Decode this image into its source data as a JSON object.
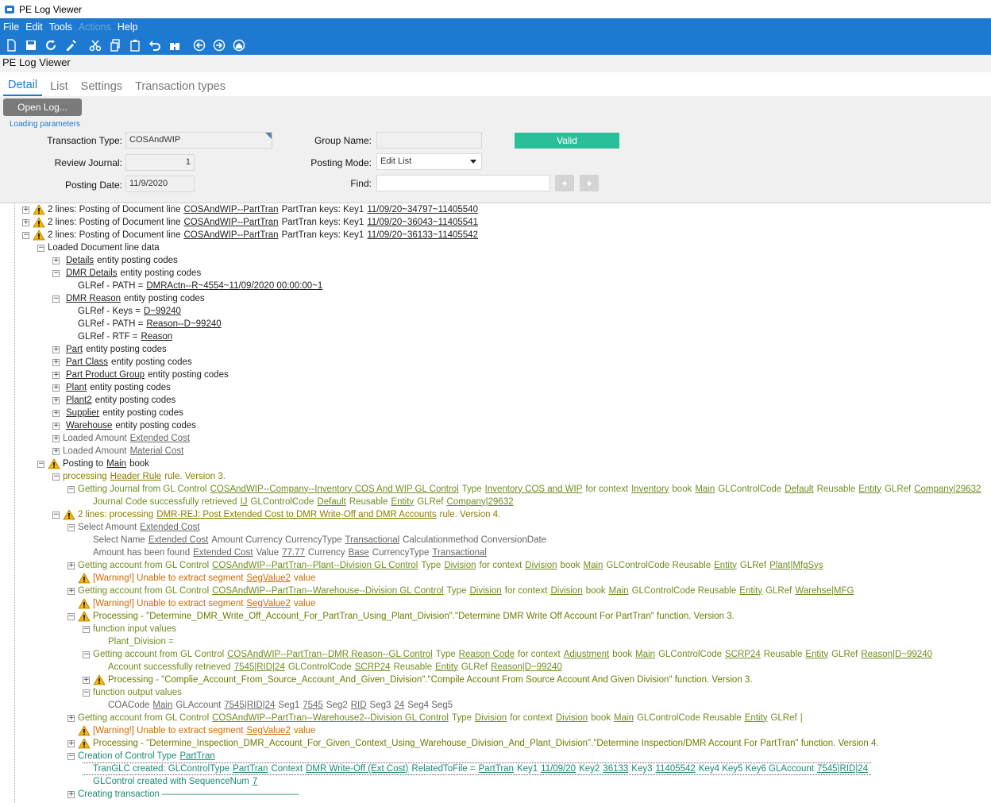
{
  "window": {
    "title": "PE Log Viewer"
  },
  "menu": {
    "file": "File",
    "edit": "Edit",
    "tools": "Tools",
    "actions": "Actions",
    "help": "Help"
  },
  "header": {
    "title": "PE Log Viewer"
  },
  "tabs": {
    "detail": "Detail",
    "list": "List",
    "settings": "Settings",
    "transaction_types": "Transaction types"
  },
  "params": {
    "open_log": "Open Log...",
    "loading_parameters": "Loading parameters",
    "transaction_type_label": "Transaction Type:",
    "transaction_type_value": "COSAndWIP",
    "review_journal_label": "Review Journal:",
    "review_journal_value": "1",
    "posting_date_label": "Posting Date:",
    "posting_date_value": "11/9/2020",
    "group_name_label": "Group Name:",
    "group_name_value": "",
    "posting_mode_label": "Posting Mode:",
    "posting_mode_value": "Edit List",
    "find_label": "Find:",
    "find_value": "",
    "status": "Valid"
  },
  "tree": [
    {
      "depth": 0,
      "exp": "+",
      "warn": true,
      "color": "c-black",
      "parts": [
        "2 lines: Posting of Document line",
        {
          "u": "COSAndWIP--PartTran"
        },
        "PartTran keys:  Key1",
        {
          "u": "11/09/20~34797~11405540"
        }
      ]
    },
    {
      "depth": 0,
      "exp": "+",
      "warn": true,
      "color": "c-black",
      "parts": [
        "2 lines: Posting of Document line",
        {
          "u": "COSAndWIP--PartTran"
        },
        "PartTran keys:  Key1",
        {
          "u": "11/09/20~36043~11405541"
        }
      ]
    },
    {
      "depth": 0,
      "exp": "-",
      "warn": true,
      "color": "c-black",
      "parts": [
        "2 lines: Posting of Document line",
        {
          "u": "COSAndWIP--PartTran"
        },
        "PartTran keys:  Key1",
        {
          "u": "11/09/20~36133~11405542"
        }
      ]
    },
    {
      "depth": 1,
      "exp": "-",
      "warn": false,
      "color": "c-black",
      "parts": [
        "Loaded Document line data"
      ]
    },
    {
      "depth": 2,
      "exp": "+",
      "warn": false,
      "color": "c-black",
      "parts": [
        {
          "u": "Details"
        },
        "entity posting codes"
      ]
    },
    {
      "depth": 2,
      "exp": "-",
      "warn": false,
      "color": "c-black",
      "parts": [
        {
          "u": "DMR Details"
        },
        "entity posting codes"
      ]
    },
    {
      "depth": 3,
      "exp": "",
      "warn": false,
      "color": "c-black",
      "parts": [
        "GLRef - PATH =",
        {
          "u": "DMRActn--R~4554~11/09/2020 00:00:00~1"
        }
      ]
    },
    {
      "depth": 2,
      "exp": "-",
      "warn": false,
      "color": "c-black",
      "parts": [
        {
          "u": "DMR Reason"
        },
        "entity posting codes"
      ]
    },
    {
      "depth": 3,
      "exp": "",
      "warn": false,
      "color": "c-black",
      "parts": [
        "GLRef - Keys =",
        {
          "u": "D~99240"
        }
      ]
    },
    {
      "depth": 3,
      "exp": "",
      "warn": false,
      "color": "c-black",
      "parts": [
        "GLRef - PATH =",
        {
          "u": "Reason--D~99240"
        }
      ]
    },
    {
      "depth": 3,
      "exp": "",
      "warn": false,
      "color": "c-black",
      "parts": [
        "GLRef - RTF =",
        {
          "u": "Reason"
        }
      ]
    },
    {
      "depth": 2,
      "exp": "+",
      "warn": false,
      "color": "c-black",
      "parts": [
        {
          "u": "Part"
        },
        "entity posting codes"
      ]
    },
    {
      "depth": 2,
      "exp": "+",
      "warn": false,
      "color": "c-black",
      "parts": [
        {
          "u": "Part Class"
        },
        "entity posting codes"
      ]
    },
    {
      "depth": 2,
      "exp": "+",
      "warn": false,
      "color": "c-black",
      "parts": [
        {
          "u": "Part Product Group"
        },
        "entity posting codes"
      ]
    },
    {
      "depth": 2,
      "exp": "+",
      "warn": false,
      "color": "c-black",
      "parts": [
        {
          "u": "Plant"
        },
        "entity posting codes"
      ]
    },
    {
      "depth": 2,
      "exp": "+",
      "warn": false,
      "color": "c-black",
      "parts": [
        {
          "u": "Plant2"
        },
        "entity posting codes"
      ]
    },
    {
      "depth": 2,
      "exp": "+",
      "warn": false,
      "color": "c-black",
      "parts": [
        {
          "u": "Supplier"
        },
        "entity posting codes"
      ]
    },
    {
      "depth": 2,
      "exp": "+",
      "warn": false,
      "color": "c-black",
      "parts": [
        {
          "u": "Warehouse"
        },
        "entity posting codes"
      ]
    },
    {
      "depth": 2,
      "exp": "+",
      "warn": false,
      "color": "c-gray",
      "parts": [
        "Loaded Amount",
        {
          "u": "Extended Cost"
        }
      ]
    },
    {
      "depth": 2,
      "exp": "+",
      "warn": false,
      "color": "c-gray",
      "parts": [
        "Loaded Amount",
        {
          "u": "Material Cost"
        }
      ]
    },
    {
      "depth": 1,
      "exp": "-",
      "warn": true,
      "color": "c-black",
      "parts": [
        "Posting to",
        {
          "u": "Main"
        },
        "book"
      ]
    },
    {
      "depth": 2,
      "exp": "-",
      "warn": false,
      "color": "c-olive",
      "parts": [
        "processing",
        {
          "u": "Header Rule"
        },
        "rule. Version 3."
      ]
    },
    {
      "depth": 3,
      "exp": "-",
      "warn": false,
      "color": "c-green",
      "parts": [
        "Getting Journal from GL Control",
        {
          "u": "COSAndWIP--Company--Inventory COS And WIP GL Control"
        },
        "Type",
        {
          "u": "Inventory COS and WIP"
        },
        "for context",
        {
          "u": "Inventory"
        },
        "book",
        {
          "u": "Main"
        },
        "GLControlCode",
        {
          "u": "Default"
        },
        "Reusable",
        {
          "u": "Entity"
        },
        "GLRef",
        {
          "u": "Company|29632"
        }
      ]
    },
    {
      "depth": 4,
      "exp": "",
      "warn": false,
      "color": "c-green",
      "parts": [
        "Journal Code successfully retrieved",
        {
          "u": "IJ"
        },
        "GLControlCode",
        {
          "u": "Default"
        },
        "Reusable",
        {
          "u": "Entity"
        },
        "GLRef",
        {
          "u": "Company|29632"
        }
      ]
    },
    {
      "depth": 2,
      "exp": "-",
      "warn": true,
      "color": "c-olive",
      "parts": [
        "2 lines: processing",
        {
          "u": "DMR-REJ: Post Extended Cost to DMR Write-Off and DMR Accounts"
        },
        "rule. Version 4."
      ]
    },
    {
      "depth": 3,
      "exp": "-",
      "warn": false,
      "color": "c-gray",
      "parts": [
        "Select Amount",
        {
          "u": "Extended Cost"
        }
      ]
    },
    {
      "depth": 4,
      "exp": "",
      "warn": false,
      "color": "c-gray",
      "parts": [
        "Select Name",
        {
          "u": "Extended Cost"
        },
        "Amount    Currency   CurrencyType",
        {
          "u": "Transactional"
        },
        "Calculationmethod    ConversionDate"
      ]
    },
    {
      "depth": 4,
      "exp": "",
      "warn": false,
      "color": "c-gray",
      "parts": [
        "Amount has been found",
        {
          "u": "Extended Cost"
        },
        "Value",
        {
          "u": "77.77"
        },
        "Currency",
        {
          "u": "Base"
        },
        "CurrencyType",
        {
          "u": "Transactional"
        }
      ]
    },
    {
      "depth": 3,
      "exp": "+",
      "warn": false,
      "color": "c-green",
      "parts": [
        "Getting account from GL Control",
        {
          "u": "COSAndWIP--PartTran--Plant--Division GL Control"
        },
        "Type",
        {
          "u": "Division"
        },
        "for context",
        {
          "u": "Division"
        },
        "book",
        {
          "u": "Main"
        },
        "GLControlCode   Reusable",
        {
          "u": "Entity"
        },
        "GLRef",
        {
          "u": "Plant|MfgSys"
        }
      ]
    },
    {
      "depth": 3,
      "exp": "",
      "warn": true,
      "color": "c-orange",
      "parts": [
        "[Warning!] Unable to extract segment",
        {
          "u": "SegValue2"
        },
        "value"
      ]
    },
    {
      "depth": 3,
      "exp": "+",
      "warn": false,
      "color": "c-green",
      "parts": [
        "Getting account from GL Control",
        {
          "u": "COSAndWIP--PartTran--Warehouse--Division GL Control"
        },
        "Type",
        {
          "u": "Division"
        },
        "for context",
        {
          "u": "Division"
        },
        "book",
        {
          "u": "Main"
        },
        "GLControlCode   Reusable",
        {
          "u": "Entity"
        },
        "GLRef",
        {
          "u": "Warehse|MFG"
        }
      ]
    },
    {
      "depth": 3,
      "exp": "",
      "warn": true,
      "color": "c-orange",
      "parts": [
        "[Warning!] Unable to extract segment",
        {
          "u": "SegValue2"
        },
        "value"
      ]
    },
    {
      "depth": 3,
      "exp": "-",
      "warn": true,
      "color": "c-warn",
      "parts": [
        "Processing - \"Determine_DMR_Write_Off_Account_For_PartTran_Using_Plant_Division\".\"Determine DMR Write Off Account For PartTran\" function. Version 3."
      ]
    },
    {
      "depth": 4,
      "exp": "-",
      "warn": false,
      "color": "c-green",
      "parts": [
        "function input values"
      ]
    },
    {
      "depth": 5,
      "exp": "",
      "warn": false,
      "color": "c-green",
      "parts": [
        "Plant_Division ="
      ]
    },
    {
      "depth": 4,
      "exp": "-",
      "warn": false,
      "color": "c-green",
      "parts": [
        "Getting account from GL Control",
        {
          "u": "COSAndWIP--PartTran--DMR Reason--GL Control"
        },
        "Type",
        {
          "u": "Reason Code"
        },
        "for context",
        {
          "u": "Adjustment"
        },
        "book",
        {
          "u": "Main"
        },
        "GLControlCode",
        {
          "u": "SCRP24"
        },
        "Reusable",
        {
          "u": "Entity"
        },
        "GLRef",
        {
          "u": "Reason|D~99240"
        }
      ]
    },
    {
      "depth": 5,
      "exp": "",
      "warn": false,
      "color": "c-green",
      "parts": [
        "Account successfully retrieved",
        {
          "u": "7545|RID|24"
        },
        "GLControlCode",
        {
          "u": "SCRP24"
        },
        "Reusable",
        {
          "u": "Entity"
        },
        "GLRef",
        {
          "u": "Reason|D~99240"
        }
      ]
    },
    {
      "depth": 4,
      "exp": "+",
      "warn": true,
      "color": "c-warn",
      "parts": [
        "Processing - \"Complie_Account_From_Source_Account_And_Given_Division\".\"Compile Account From Source Account And Given Division\" function. Version 3."
      ]
    },
    {
      "depth": 4,
      "exp": "-",
      "warn": false,
      "color": "c-green",
      "parts": [
        "function output values"
      ]
    },
    {
      "depth": 5,
      "exp": "",
      "warn": false,
      "color": "c-gray",
      "parts": [
        "COACode",
        {
          "u": "Main"
        },
        "GLAccount",
        {
          "u": "7545|RID|24"
        },
        "Seg1",
        {
          "u": "7545"
        },
        "Seg2",
        {
          "u": "RID"
        },
        "Seg3",
        {
          "u": "24"
        },
        "Seg4    Seg5"
      ]
    },
    {
      "depth": 3,
      "exp": "+",
      "warn": false,
      "color": "c-green",
      "parts": [
        "Getting account from GL Control",
        {
          "u": "COSAndWIP--PartTran--Warehouse2--Division GL Control"
        },
        "Type",
        {
          "u": "Division"
        },
        "for context",
        {
          "u": "Division"
        },
        "book",
        {
          "u": "Main"
        },
        "GLControlCode   Reusable",
        {
          "u": "Entity"
        },
        "GLRef",
        {
          "u": "|"
        }
      ]
    },
    {
      "depth": 3,
      "exp": "",
      "warn": true,
      "color": "c-orange",
      "parts": [
        "[Warning!] Unable to extract segment",
        {
          "u": "SegValue2"
        },
        "value"
      ]
    },
    {
      "depth": 3,
      "exp": "+",
      "warn": true,
      "color": "c-warn",
      "parts": [
        "Processing - \"Determine_Inspection_DMR_Account_For_Given_Context_Using_Warehouse_Division_And_Plant_Division\".\"Determine Inspection/DMR Account For PartTran\" function. Version 4."
      ]
    },
    {
      "depth": 3,
      "exp": "-",
      "warn": false,
      "color": "c-teal",
      "parts": [
        "Creation of Control Type",
        {
          "u": "PartTran"
        }
      ]
    },
    {
      "depth": 4,
      "exp": "",
      "warn": false,
      "color": "c-teal",
      "boxed": true,
      "parts": [
        "TranGLC created: GLControlType",
        {
          "u": "PartTran"
        },
        "Context",
        {
          "u": "DMR Write-Off (Ext Cost)"
        },
        "RelatedToFile =",
        {
          "u": "PartTran"
        },
        "Key1",
        {
          "u": "11/09/20"
        },
        "Key2",
        {
          "u": "36133"
        },
        "Key3",
        {
          "u": "11405542"
        },
        "Key4    Key5    Key6    GLAccount",
        {
          "u": "7545|RID|24"
        }
      ]
    },
    {
      "depth": 4,
      "exp": "",
      "warn": false,
      "color": "c-teal",
      "parts": [
        "GLControl created with SequenceNum",
        {
          "u": "7"
        }
      ]
    },
    {
      "depth": 3,
      "exp": "+",
      "warn": false,
      "color": "c-teal",
      "parts": [
        "Creating transaction ———————————————"
      ]
    }
  ]
}
